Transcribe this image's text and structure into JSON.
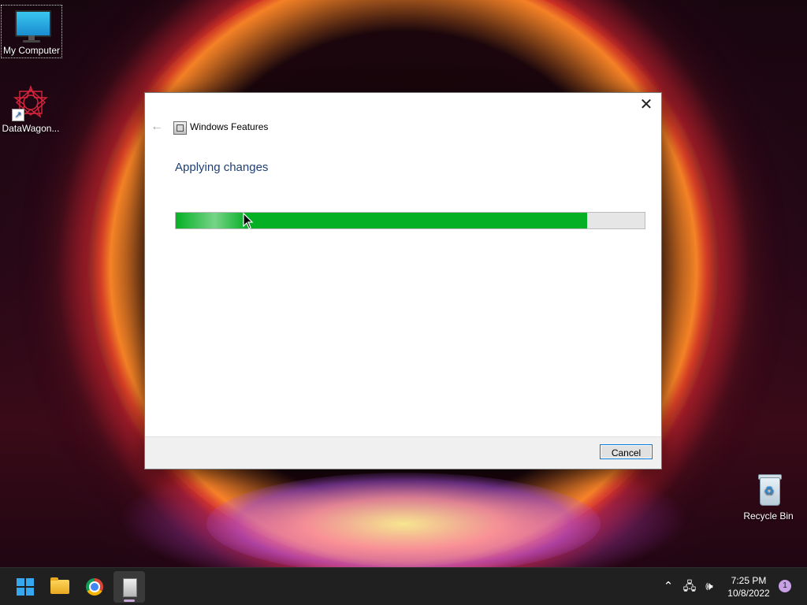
{
  "desktop": {
    "icons": [
      {
        "label": "My Computer"
      },
      {
        "label": "DataWagon..."
      },
      {
        "label": "Recycle Bin"
      }
    ]
  },
  "dialog": {
    "title": "Windows Features",
    "heading": "Applying changes",
    "progress_fraction": 0.878,
    "progress_color": "#06b025",
    "cancel_label": "Cancel",
    "close_glyph": "✕",
    "back_glyph": "←"
  },
  "taskbar": {
    "apps": [
      {
        "name": "start-icon"
      },
      {
        "name": "file-explorer-icon"
      },
      {
        "name": "chrome-icon"
      },
      {
        "name": "windows-features-icon"
      }
    ],
    "tray": {
      "chevron_glyph": "⌃",
      "network_glyph": "🖧",
      "volume_glyph": "🕪"
    },
    "clock": {
      "time": "7:25 PM",
      "date": "10/8/2022"
    },
    "notification_count": "1"
  }
}
